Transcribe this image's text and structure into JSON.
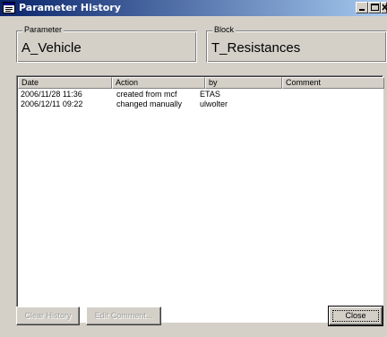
{
  "window": {
    "title": "Parameter History",
    "title_bar_color": "#0a246a",
    "face_color": "#d4d0c8",
    "icons": [
      "app-icon",
      "minimize-icon",
      "maximize-icon",
      "close-icon"
    ]
  },
  "parameter": {
    "label": "Parameter",
    "value": "A_Vehicle"
  },
  "block": {
    "label": "Block",
    "value": "T_Resistances"
  },
  "history": {
    "columns": [
      "Date",
      "Action",
      "by",
      "Comment"
    ],
    "rows": [
      {
        "date": "2006/11/28  11:36",
        "action": "created from mcf",
        "by": "ETAS",
        "comment": ""
      },
      {
        "date": "2006/12/11  09:22",
        "action": "changed manually",
        "by": "ulwolter",
        "comment": ""
      }
    ]
  },
  "buttons": {
    "clear_history": "Clear History",
    "edit_comment": "Edit Comment...",
    "close": "Close"
  }
}
